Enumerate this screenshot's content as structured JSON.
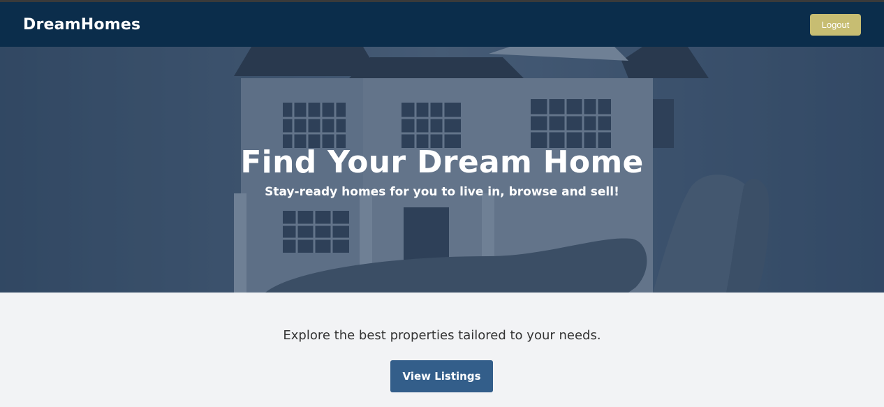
{
  "navbar": {
    "brand": "DreamHomes",
    "logout_label": "Logout"
  },
  "hero": {
    "title": "Find Your Dream Home",
    "subtitle": "Stay-ready homes for you to live in, browse and sell!"
  },
  "main": {
    "tagline": "Explore the best properties tailored to your needs.",
    "cta_label": "View Listings"
  },
  "colors": {
    "navbar_bg": "#0b2d4b",
    "logout_bg": "#c7bd72",
    "cta_bg": "#335e8a",
    "page_bg": "#f2f3f5"
  }
}
